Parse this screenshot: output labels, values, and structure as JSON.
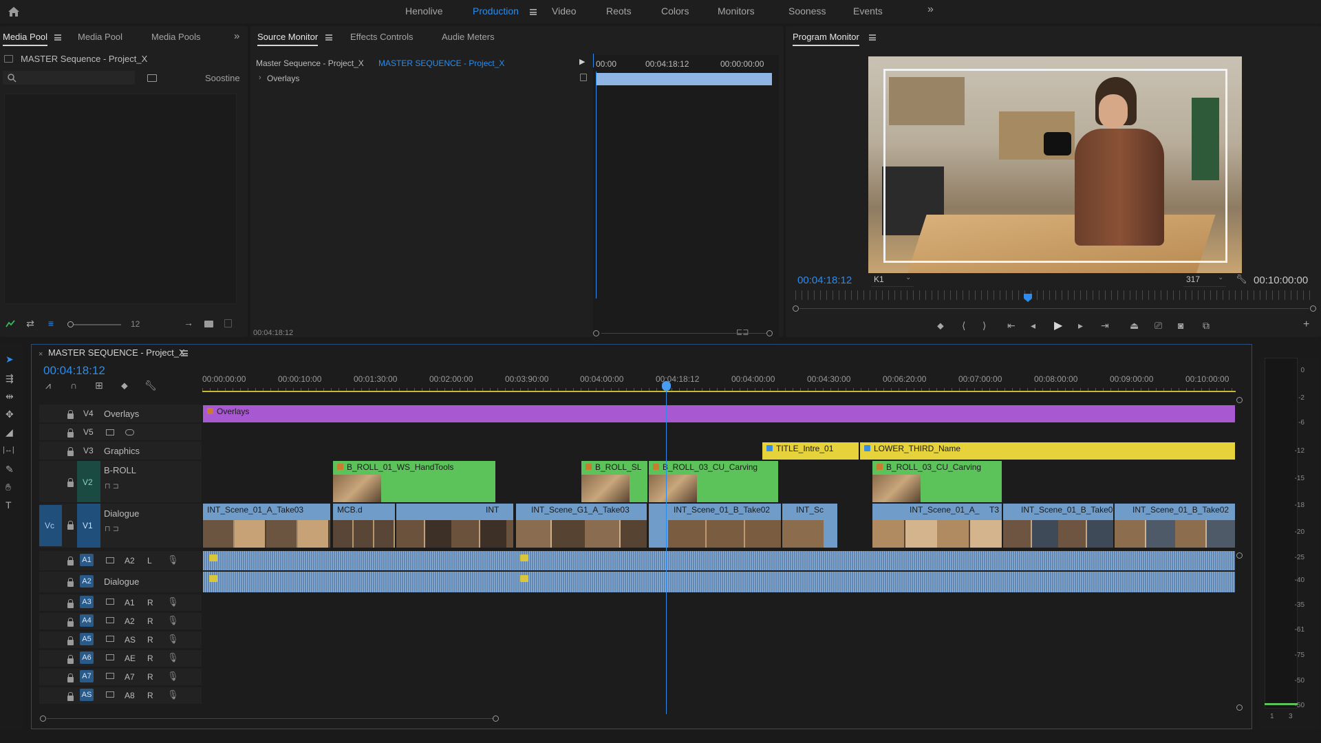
{
  "workspace_tabs": [
    {
      "label": "Henolive",
      "active": false
    },
    {
      "label": "Production",
      "active": true
    },
    {
      "label": "Video",
      "active": false
    },
    {
      "label": "Reots",
      "active": false
    },
    {
      "label": "Colors",
      "active": false
    },
    {
      "label": "Monitors",
      "active": false
    },
    {
      "label": "Sooness",
      "active": false
    },
    {
      "label": "Events",
      "active": false
    }
  ],
  "overflow_symbol": "»",
  "media_panel": {
    "tabs": [
      "Media Pool",
      "Media Pool",
      "Media Pools"
    ],
    "path": "MASTER Sequence - Project_X",
    "search_placeholder": "",
    "sort_label": "Soostine",
    "zoom_value": "12"
  },
  "source_monitor": {
    "tabs": [
      "Source Monitor",
      "Effects Controls",
      "Audie Meters"
    ],
    "seq_name": "Master Sequence - Project_X",
    "seq_link": "MASTER SEQUENCE - Project_X",
    "overlay_row": "Overlays",
    "ruler": [
      "00:00",
      "00:04:18:12",
      "00:00:00:00"
    ],
    "timecode": "00:04:18:12"
  },
  "program_monitor": {
    "title": "Program Monitor",
    "timecode": "00:04:18:12",
    "fit_select": "K1",
    "quality_select": "317",
    "duration": "00:10:00:00"
  },
  "timeline": {
    "title": "MASTER SEQUENCE - Project_X",
    "timecode": "00:04:18:12",
    "ruler": [
      "00:00:00:00",
      "00:00:10:00",
      "00:01:30:00",
      "00:02:00:00",
      "00:03:90:00",
      "00:04:00:00",
      "00:04:18:12",
      "00:04:00:00",
      "00:04:30:00",
      "00:06:20:00",
      "00:07:00:00",
      "00:08:00:00",
      "00:09:00:00",
      "00:10:00:00"
    ],
    "tracks": {
      "v4": {
        "id": "V4",
        "name": "Overlays"
      },
      "v5": {
        "id": "V5"
      },
      "v3": {
        "id": "V3",
        "name": "Graphics"
      },
      "v2": {
        "id": "V2",
        "name": "B-ROLL"
      },
      "v1": {
        "id": "V1",
        "name": "Dialogue",
        "src": "Vc"
      },
      "a1": {
        "id": "A1",
        "src": "A2",
        "flag": "L"
      },
      "a2": {
        "id": "A2",
        "name": "Dialogue"
      },
      "a3": {
        "id": "A3",
        "src": "A1",
        "flag": "R"
      },
      "a4": {
        "id": "A4",
        "src": "A2",
        "flag": "R"
      },
      "a5": {
        "id": "A5",
        "src": "AS",
        "flag": "R"
      },
      "a6": {
        "id": "A6",
        "src": "AE",
        "flag": "R"
      },
      "a7": {
        "id": "A7",
        "src": "A7",
        "flag": "R"
      },
      "a8": {
        "id": "AS",
        "src": "A8",
        "flag": "R"
      }
    },
    "clips": {
      "overlays": "Overlays",
      "title_intro": "TITLE_Intre_01",
      "lower_third": "LOWER_THIRD_Name",
      "broll1": "B_ROLL_01_WS_HandTools",
      "broll2": "B_ROLL_SL",
      "broll3": "B_ROLL_03_CU_Carving",
      "broll4": "B_ROLL_03_CU_Carving",
      "v1_1": "INT_Scene_01_A_Take03",
      "v1_2": "MCB.d",
      "v1_3": "INT",
      "v1_4": "INT_Scene_G1_A_Take03",
      "v1_5": "INT_Scene_01_B_Take02",
      "v1_6": "INT_Sc",
      "v1_7": "INT_Scene_01_A_",
      "v1_8": "INT_Scene_01_B_Take02",
      "v1_9": "INT_Scene_01_B_Take02",
      "v1_10": "T3"
    }
  },
  "meter": {
    "ticks": [
      "0",
      "-2",
      "-6",
      "-12",
      "-15",
      "-18",
      "-20",
      "-25",
      "-40",
      "-35",
      "-61",
      "-75",
      "-50",
      "-50"
    ],
    "channels": [
      "1",
      "3"
    ]
  },
  "colors": {
    "accent": "#2d8ceb",
    "clip_green": "#5cc25a",
    "clip_blue": "#6f9cc9",
    "clip_yellow": "#e6d23a",
    "clip_purple": "#a858d0"
  }
}
